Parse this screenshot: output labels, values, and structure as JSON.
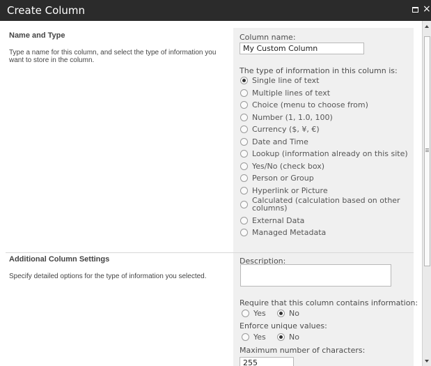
{
  "window": {
    "title": "Create Column"
  },
  "sections": {
    "name_type": {
      "title": "Name and Type",
      "description": "Type a name for this column, and select the type of information you want to store in the column."
    },
    "additional": {
      "title": "Additional Column Settings",
      "description": "Specify detailed options for the type of information you selected."
    }
  },
  "fields": {
    "column_name_label": "Column name:",
    "column_name_value": "My Custom Column",
    "type_label": "The type of information in this column is:",
    "types": [
      {
        "label": "Single line of text",
        "selected": true
      },
      {
        "label": "Multiple lines of text",
        "selected": false
      },
      {
        "label": "Choice (menu to choose from)",
        "selected": false
      },
      {
        "label": "Number (1, 1.0, 100)",
        "selected": false
      },
      {
        "label": "Currency ($, ¥, €)",
        "selected": false
      },
      {
        "label": "Date and Time",
        "selected": false
      },
      {
        "label": "Lookup (information already on this site)",
        "selected": false
      },
      {
        "label": "Yes/No (check box)",
        "selected": false
      },
      {
        "label": "Person or Group",
        "selected": false
      },
      {
        "label": "Hyperlink or Picture",
        "selected": false
      },
      {
        "label": "Calculated (calculation based on other columns)",
        "selected": false
      },
      {
        "label": "External Data",
        "selected": false
      },
      {
        "label": "Managed Metadata",
        "selected": false
      }
    ],
    "description_label": "Description:",
    "description_value": "",
    "require_label": "Require that this column contains information:",
    "require_options": [
      {
        "label": "Yes",
        "selected": false
      },
      {
        "label": "No",
        "selected": true
      }
    ],
    "unique_label": "Enforce unique values:",
    "unique_options": [
      {
        "label": "Yes",
        "selected": false
      },
      {
        "label": "No",
        "selected": true
      }
    ],
    "maxchars_label": "Maximum number of characters:",
    "maxchars_value": "255"
  }
}
